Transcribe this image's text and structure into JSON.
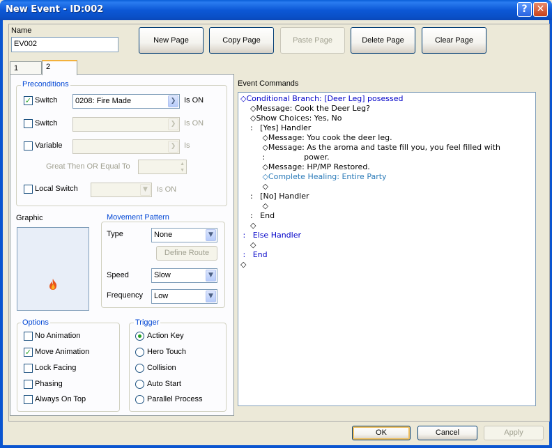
{
  "window": {
    "title": "New Event - ID:002"
  },
  "name_field": {
    "label": "Name",
    "value": "EV002"
  },
  "page_buttons": {
    "new": "New Page",
    "copy": "Copy Page",
    "paste": "Paste Page",
    "delete": "Delete Page",
    "clear": "Clear Page"
  },
  "tabs": [
    {
      "label": "1"
    },
    {
      "label": "2"
    }
  ],
  "preconditions": {
    "title": "Preconditions",
    "switch1": {
      "label": "Switch",
      "checked": true,
      "value": "0208: Fire Made",
      "suffix": "Is ON"
    },
    "switch2": {
      "label": "Switch",
      "checked": false,
      "value": "",
      "suffix": "Is ON"
    },
    "variable": {
      "label": "Variable",
      "checked": false,
      "value": "",
      "suffix": "Is"
    },
    "compare_label": "Great Then OR Equal To",
    "local_switch": {
      "label": "Local Switch",
      "checked": false,
      "suffix": "Is ON"
    }
  },
  "graphic": {
    "label": "Graphic",
    "icon": "flame-icon"
  },
  "movement": {
    "title": "Movement Pattern",
    "type_label": "Type",
    "type_value": "None",
    "define_route": "Define Route",
    "speed_label": "Speed",
    "speed_value": "Slow",
    "frequency_label": "Frequency",
    "frequency_value": "Low"
  },
  "options": {
    "title": "Options",
    "items": [
      {
        "label": "No Animation",
        "checked": false
      },
      {
        "label": "Move Animation",
        "checked": true
      },
      {
        "label": "Lock Facing",
        "checked": false
      },
      {
        "label": "Phasing",
        "checked": false
      },
      {
        "label": "Always On Top",
        "checked": false
      }
    ]
  },
  "trigger": {
    "title": "Trigger",
    "items": [
      {
        "label": "Action Key",
        "selected": true
      },
      {
        "label": "Hero Touch",
        "selected": false
      },
      {
        "label": "Collision",
        "selected": false
      },
      {
        "label": "Auto Start",
        "selected": false
      },
      {
        "label": "Parallel Process",
        "selected": false
      }
    ]
  },
  "event_commands": {
    "label": "Event Commands",
    "lines": [
      {
        "text": "◇Conditional Branch: [Deer Leg] posessed",
        "style": "blue"
      },
      {
        "text": "    ◇Message: Cook the Deer Leg?",
        "style": "black"
      },
      {
        "text": "    ◇Show Choices: Yes, No",
        "style": "black"
      },
      {
        "text": "    :   [Yes] Handler",
        "style": "black"
      },
      {
        "text": "         ◇Message: You cook the deer leg.",
        "style": "black"
      },
      {
        "text": "         ◇Message: As the aroma and taste fill you, you feel filled with",
        "style": "black"
      },
      {
        "text": "         :                power.",
        "style": "black"
      },
      {
        "text": "         ◇Message: HP/MP Restored.",
        "style": "black"
      },
      {
        "text": "         ◇Complete Healing: Entire Party",
        "style": "teal"
      },
      {
        "text": "         ◇",
        "style": "black"
      },
      {
        "text": "    :   [No] Handler",
        "style": "black"
      },
      {
        "text": "         ◇",
        "style": "black"
      },
      {
        "text": "    :   End",
        "style": "black"
      },
      {
        "text": "    ◇",
        "style": "black"
      },
      {
        "text": " :   Else Handler",
        "style": "blue"
      },
      {
        "text": "    ◇",
        "style": "black"
      },
      {
        "text": " :   End",
        "style": "blue"
      },
      {
        "text": "◇",
        "style": "black"
      }
    ]
  },
  "footer": {
    "ok": "OK",
    "cancel": "Cancel",
    "apply": "Apply"
  },
  "colors": {
    "title_bar": "#0a5fd8",
    "accent_blue": "#0046d5",
    "check_green": "#21a121",
    "tab_highlight": "#f3b13c"
  }
}
